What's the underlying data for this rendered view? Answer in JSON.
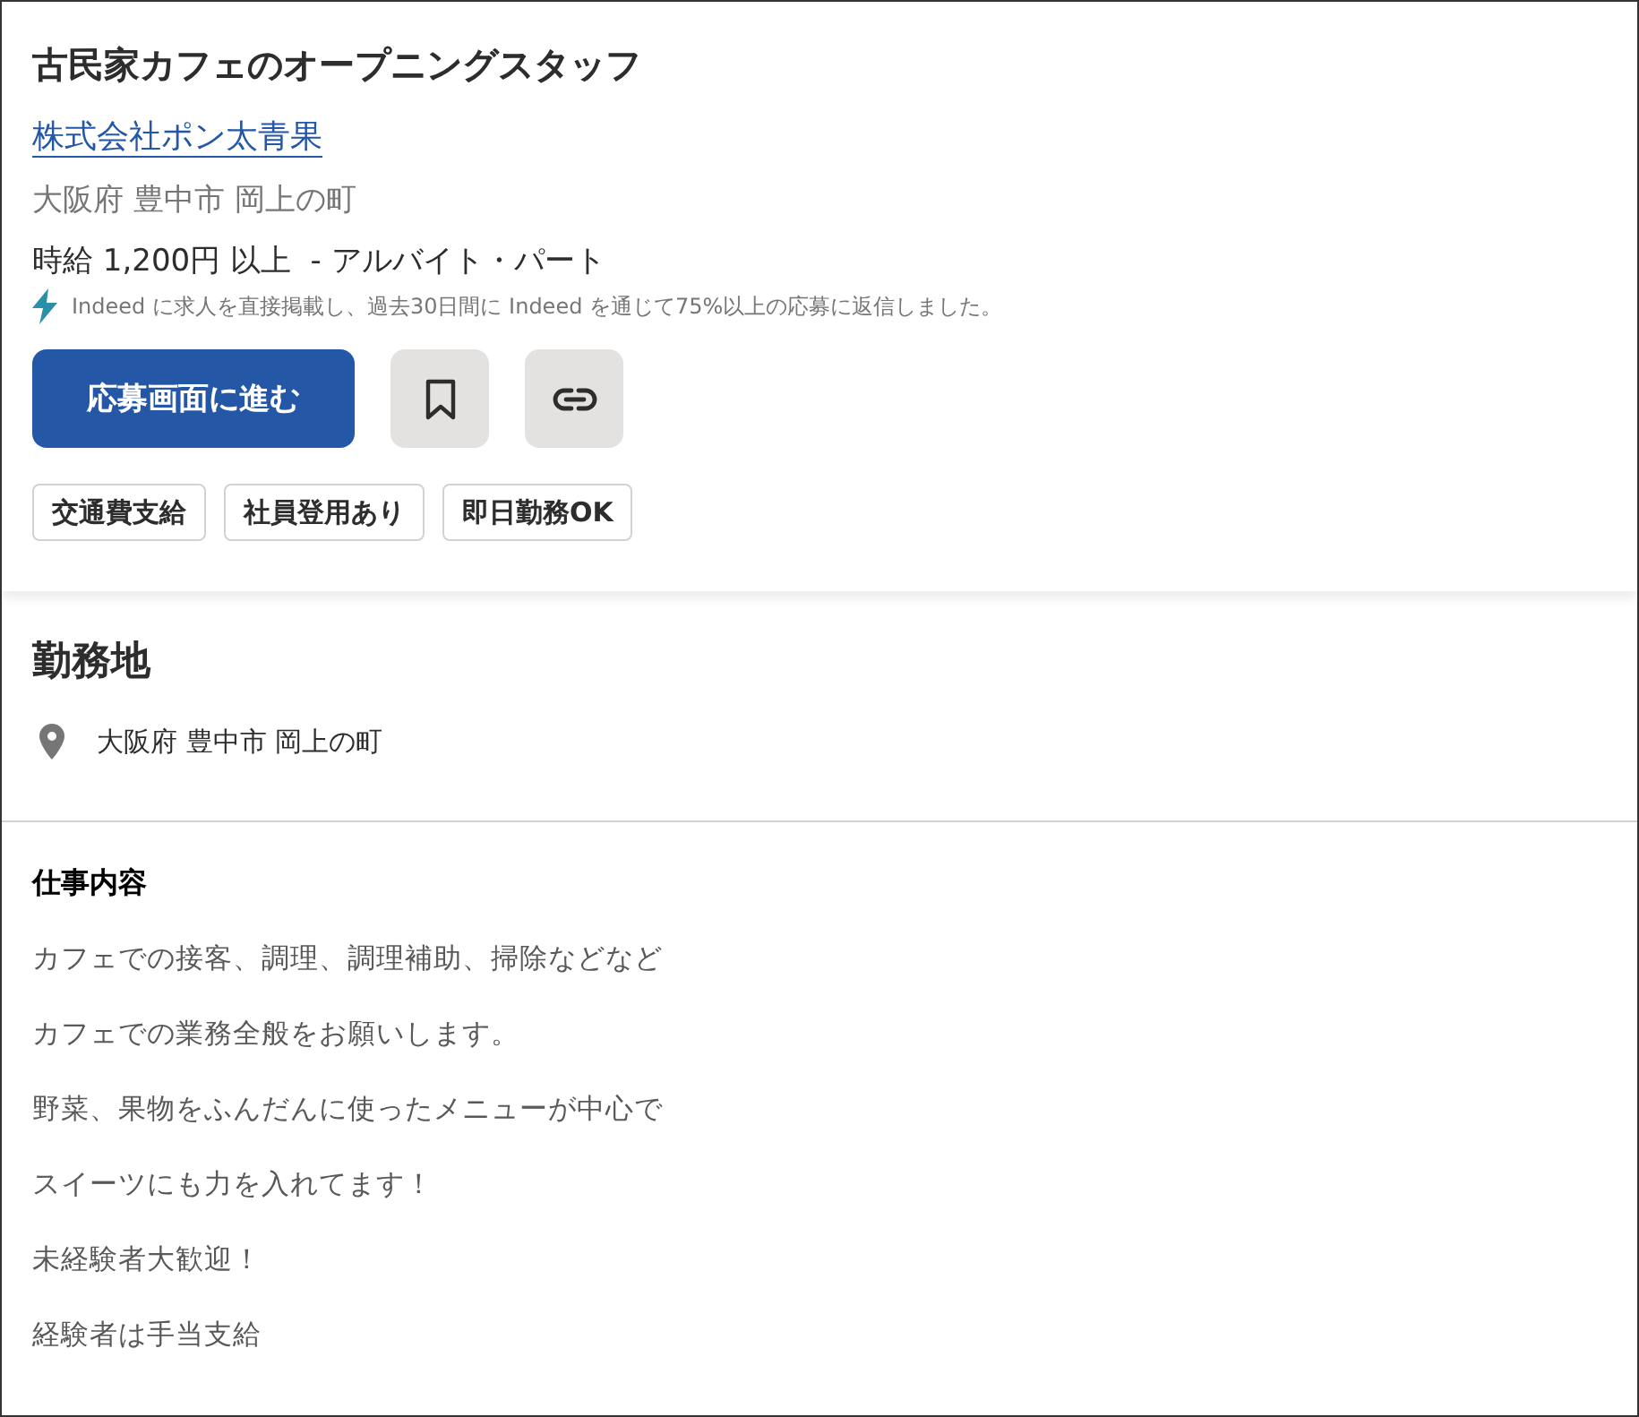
{
  "header": {
    "title": "古民家カフェのオープニングスタッフ",
    "company": "株式会社ポン太青果",
    "location": "大阪府 豊中市 岡上の町",
    "salary": "時給 1,200円 以上  - アルバイト・パート",
    "responsive_note": "Indeed に求人を直接掲載し、過去30日間に Indeed を通じて75%以上の応募に返信しました。"
  },
  "actions": [
    {
      "kind": "apply",
      "label": "応募画面に進む"
    },
    {
      "kind": "save"
    },
    {
      "kind": "copy_link"
    }
  ],
  "tags": [
    "交通費支給",
    "社員登用あり",
    "即日勤務OK"
  ],
  "work_location": {
    "heading": "勤務地",
    "address": "大阪府 豊中市 岡上の町"
  },
  "description": {
    "heading": "仕事内容",
    "paragraphs": [
      "カフェでの接客、調理、調理補助、掃除などなど",
      "カフェでの業務全般をお願いします。",
      "野菜、果物をふんだんに使ったメニューが中心で",
      "スイーツにも力を入れてます！",
      "未経験者大歓迎！",
      "経験者は手当支給"
    ]
  }
}
